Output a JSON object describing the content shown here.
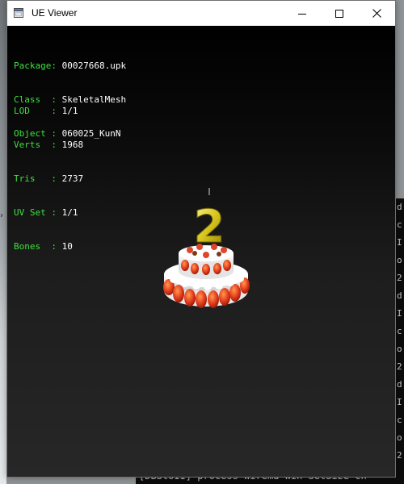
{
  "window": {
    "title": "UE Viewer",
    "controls": [
      "minimize",
      "maximize",
      "close"
    ]
  },
  "info": {
    "group1": [
      {
        "label": "Package:",
        "value": "00027668.upk"
      },
      {
        "label": "Class  :",
        "value": "SkeletalMesh"
      },
      {
        "label": "Object :",
        "value": "060025_KunN"
      }
    ],
    "group2": [
      {
        "label": "LOD    :",
        "value": "1/1"
      },
      {
        "label": "Verts  :",
        "value": "1968"
      },
      {
        "label": "Tris   :",
        "value": "2737"
      },
      {
        "label": "UV Set :",
        "value": "1/1"
      },
      {
        "label": "Bones  :",
        "value": "10"
      }
    ]
  },
  "model": {
    "candle_number": "2"
  },
  "background": {
    "console_bottom_text": "[DBStOII] process  Wiremd Win SetSize  ch"
  },
  "colors": {
    "label": "#3ee03e",
    "value": "#ffffff",
    "viewport_top": "#000000",
    "viewport_bottom": "#272727"
  }
}
